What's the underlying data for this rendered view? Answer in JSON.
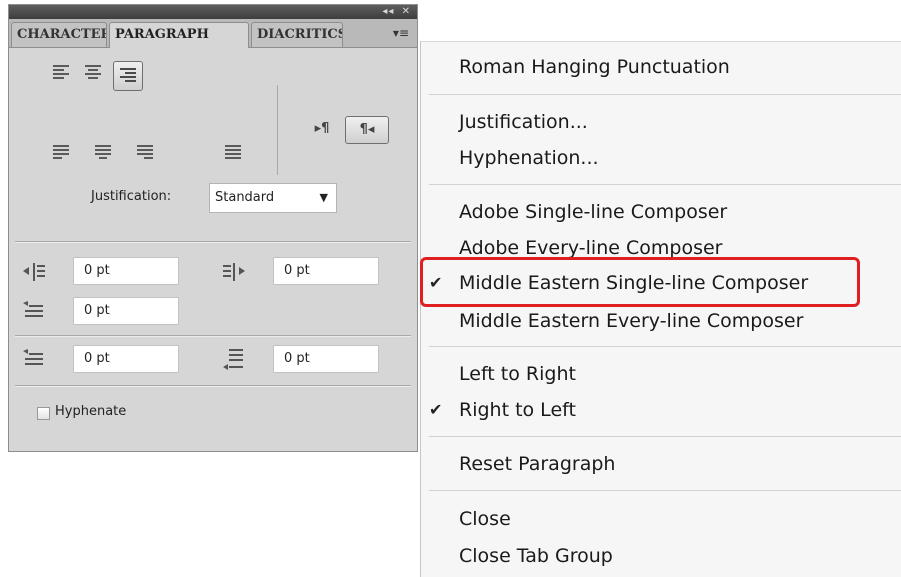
{
  "panel": {
    "titlebar": {
      "collapse_glyph": "◂◂",
      "close_glyph": "✕"
    },
    "tabs": [
      {
        "label": "CHARACTER",
        "active": false
      },
      {
        "label": "PARAGRAPH",
        "active": true
      },
      {
        "label": "DIACRITICS",
        "active": false
      }
    ],
    "menu_glyph": "▾≡",
    "alignment_icons": [
      "align-left-icon",
      "align-center-icon",
      "align-right-icon",
      "justify-last-left-icon",
      "justify-last-center-icon",
      "justify-last-right-icon",
      "justify-all-icon"
    ],
    "direction": {
      "ltr_label": "▸¶",
      "rtl_label": "¶◂",
      "selected": "rtl"
    },
    "justification": {
      "label": "Justification:",
      "value": "Standard",
      "arrow": "▼"
    },
    "fields": {
      "left_indent": "0 pt",
      "right_indent": "0 pt",
      "first_line_indent": "0 pt",
      "space_before": "0 pt",
      "space_after": "0 pt"
    },
    "hyphenate": {
      "label": "Hyphenate",
      "checked": false
    }
  },
  "menu": {
    "items": [
      {
        "label": "Roman Hanging Punctuation",
        "checked": false
      },
      {
        "label": "Justification...",
        "checked": false
      },
      {
        "label": "Hyphenation...",
        "checked": false
      },
      {
        "label": "Adobe Single-line Composer",
        "checked": false
      },
      {
        "label": "Adobe Every-line Composer",
        "checked": false
      },
      {
        "label": "Middle Eastern Single-line Composer",
        "checked": true,
        "highlighted": true
      },
      {
        "label": "Middle Eastern Every-line Composer",
        "checked": false
      },
      {
        "label": "Left to Right",
        "checked": false
      },
      {
        "label": "Right to Left",
        "checked": true
      },
      {
        "label": "Reset Paragraph",
        "checked": false
      },
      {
        "label": "Close",
        "checked": false
      },
      {
        "label": "Close Tab Group",
        "checked": false
      }
    ],
    "check_glyph": "✔",
    "highlight_color": "#e02020"
  }
}
